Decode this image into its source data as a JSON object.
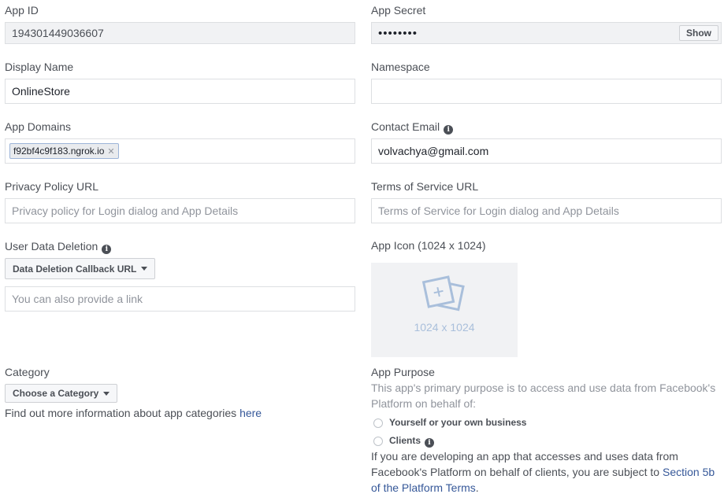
{
  "app_id": {
    "label": "App ID",
    "value": "194301449036607"
  },
  "app_secret": {
    "label": "App Secret",
    "value": "••••••••",
    "show_label": "Show"
  },
  "display_name": {
    "label": "Display Name",
    "value": "OnlineStore"
  },
  "namespace": {
    "label": "Namespace",
    "value": ""
  },
  "app_domains": {
    "label": "App Domains",
    "tags": [
      "f92bf4c9f183.ngrok.io"
    ]
  },
  "contact_email": {
    "label": "Contact Email",
    "value": "volvachya@gmail.com"
  },
  "privacy_policy": {
    "label": "Privacy Policy URL",
    "placeholder": "Privacy policy for Login dialog and App Details"
  },
  "terms_of_service": {
    "label": "Terms of Service URL",
    "placeholder": "Terms of Service for Login dialog and App Details"
  },
  "user_data_deletion": {
    "label": "User Data Deletion",
    "dropdown_label": "Data Deletion Callback URL",
    "placeholder": "You can also provide a link"
  },
  "app_icon": {
    "label": "App Icon (1024 x 1024)",
    "size_text": "1024 x 1024"
  },
  "category": {
    "label": "Category",
    "dropdown_label": "Choose a Category",
    "info_text": "Find out more information about app categories ",
    "info_link": "here"
  },
  "app_purpose": {
    "label": "App Purpose",
    "description_line1": "This app's primary purpose is to access and use data from Facebook's",
    "description_line2": "Platform on behalf of:",
    "option_yourself": "Yourself or your own business",
    "option_clients": "Clients",
    "note_line1": "If you are developing an app that accesses and uses data from",
    "note_line2": "Facebook's Platform on behalf of clients, you are subject to ",
    "note_link_part1": "Section 5b",
    "note_link_part2": "of the Platform Terms",
    "note_end": "."
  },
  "colors": {
    "link": "#365899",
    "tag_bg": "#e9ebee",
    "tag_border": "#bec3c9",
    "icon_placeholder_bg": "#f1f2f4"
  }
}
